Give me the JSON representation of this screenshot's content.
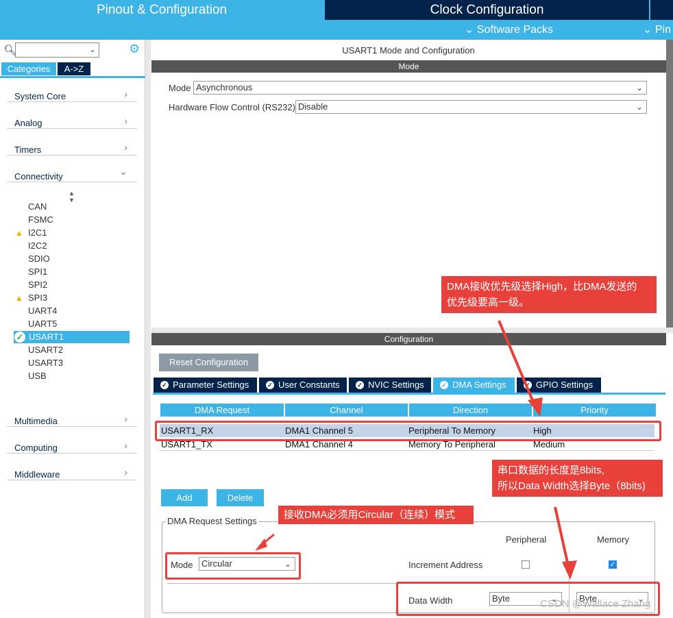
{
  "top_tabs": {
    "pinout": "Pinout & Configuration",
    "clock": "Clock Configuration",
    "software_packs": "Software Packs",
    "pinout_short": "Pin"
  },
  "sidebar": {
    "tabs": [
      "Categories",
      "A->Z"
    ],
    "categories": [
      {
        "label": "System Core",
        "arrow": "›"
      },
      {
        "label": "Analog",
        "arrow": "›"
      },
      {
        "label": "Timers",
        "arrow": "›"
      },
      {
        "label": "Connectivity",
        "arrow": "⌄"
      },
      {
        "label": "Multimedia",
        "arrow": "›"
      },
      {
        "label": "Computing",
        "arrow": "›"
      },
      {
        "label": "Middleware",
        "arrow": "›"
      }
    ],
    "peripherals": [
      "CAN",
      "FSMC",
      "I2C1",
      "I2C2",
      "SDIO",
      "SPI1",
      "SPI2",
      "SPI3",
      "UART4",
      "UART5",
      "USART1",
      "USART2",
      "USART3",
      "USB"
    ],
    "selected": "USART1"
  },
  "mode": {
    "title": "USART1 Mode and Configuration",
    "section": "Mode",
    "mode_label": "Mode",
    "mode_value": "Asynchronous",
    "hfc_label": "Hardware Flow Control (RS232)",
    "hfc_value": "Disable"
  },
  "configuration": {
    "section": "Configuration",
    "reset_label": "Reset Configuration",
    "tabs": [
      "Parameter Settings",
      "User Constants",
      "NVIC Settings",
      "DMA Settings",
      "GPIO Settings"
    ],
    "active_tab": "DMA Settings",
    "table": {
      "headers": [
        "DMA Request",
        "Channel",
        "Direction",
        "Priority"
      ],
      "rows": [
        [
          "USART1_RX",
          "DMA1 Channel 5",
          "Peripheral To Memory",
          "High"
        ],
        [
          "USART1_TX",
          "DMA1 Channel 4",
          "Memory To Peripheral",
          "Medium"
        ]
      ]
    },
    "add_label": "Add",
    "delete_label": "Delete",
    "request_settings": {
      "legend": "DMA Request Settings",
      "peripheral_label": "Peripheral",
      "memory_label": "Memory",
      "mode_label": "Mode",
      "mode_value": "Circular",
      "increment_label": "Increment Address",
      "peripheral_increment": false,
      "memory_increment": true,
      "data_width_label": "Data Width",
      "data_width_peripheral": "Byte",
      "data_width_memory": "Byte"
    }
  },
  "annotations": {
    "priority_line1": "DMA接收优先级选择High，比DMA发送的",
    "priority_line2": "优先级要高一级。",
    "width_line1": "串口数据的长度是8bits,",
    "width_line2": "所以Data Width选择Byte（8bits)",
    "circular": "接收DMA必须用Circular（连续）模式"
  },
  "watermark": "CSDN @Wallace Zhang",
  "colors": {
    "accent": "#3cb4e6",
    "dark": "#03234b",
    "annotation": "#e8413b",
    "section_bar": "#555555"
  }
}
